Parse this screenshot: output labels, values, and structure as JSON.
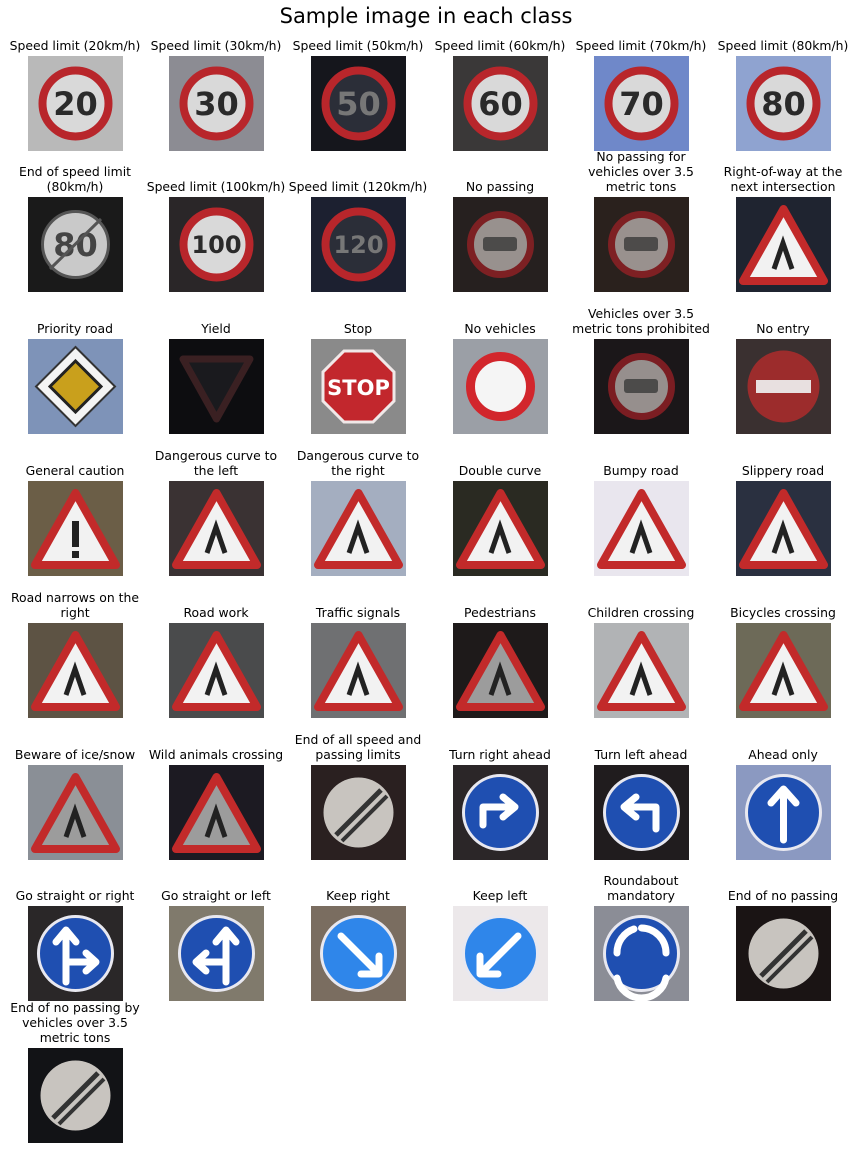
{
  "figure": {
    "title": "Sample image in each class"
  },
  "classes": [
    {
      "label": "Speed limit (20km/h)",
      "bg": "#b9b9b9",
      "sign": "speed",
      "text": "20"
    },
    {
      "label": "Speed limit (30km/h)",
      "bg": "#8c8c93",
      "sign": "speed",
      "text": "30"
    },
    {
      "label": "Speed limit (50km/h)",
      "bg": "#15161c",
      "sign": "speed-dark",
      "text": "50"
    },
    {
      "label": "Speed limit (60km/h)",
      "bg": "#3a3838",
      "sign": "speed",
      "text": "60"
    },
    {
      "label": "Speed limit (70km/h)",
      "bg": "#6f88c9",
      "sign": "speed",
      "text": "70"
    },
    {
      "label": "Speed limit (80km/h)",
      "bg": "#8fa3d0",
      "sign": "speed",
      "text": "80"
    },
    {
      "label": "End of speed limit (80km/h)",
      "bg": "#1a1a1a",
      "sign": "end-speed",
      "text": "80"
    },
    {
      "label": "Speed limit (100km/h)",
      "bg": "#2a2628",
      "sign": "speed",
      "text": "100"
    },
    {
      "label": "Speed limit (120km/h)",
      "bg": "#1c2030",
      "sign": "speed-dark",
      "text": "120"
    },
    {
      "label": "No passing",
      "bg": "#26201f",
      "sign": "prohibit",
      "text": ""
    },
    {
      "label": "No passing for vehicles over 3.5 metric tons",
      "bg": "#2a211d",
      "sign": "prohibit",
      "text": ""
    },
    {
      "label": "Right-of-way at the next intersection",
      "bg": "#1f2430",
      "sign": "triangle",
      "text": ""
    },
    {
      "label": "Priority road",
      "bg": "#7e93b8",
      "sign": "priority",
      "text": ""
    },
    {
      "label": "Yield",
      "bg": "#0d0d10",
      "sign": "yield",
      "text": ""
    },
    {
      "label": "Stop",
      "bg": "#8a8a8a",
      "sign": "stop",
      "text": "STOP"
    },
    {
      "label": "No vehicles",
      "bg": "#9b9fa6",
      "sign": "no-vehicles",
      "text": ""
    },
    {
      "label": "Vehicles over 3.5 metric tons prohibited",
      "bg": "#1b1719",
      "sign": "prohibit",
      "text": ""
    },
    {
      "label": "No entry",
      "bg": "#3a3030",
      "sign": "no-entry",
      "text": ""
    },
    {
      "label": "General caution",
      "bg": "#6b5e47",
      "sign": "triangle",
      "text": "!"
    },
    {
      "label": "Dangerous curve to the left",
      "bg": "#3a3233",
      "sign": "triangle",
      "text": ""
    },
    {
      "label": "Dangerous curve to the right",
      "bg": "#a4aec0",
      "sign": "triangle",
      "text": ""
    },
    {
      "label": "Double curve",
      "bg": "#2a2a22",
      "sign": "triangle",
      "text": ""
    },
    {
      "label": "Bumpy road",
      "bg": "#e9e6ee",
      "sign": "triangle",
      "text": ""
    },
    {
      "label": "Slippery road",
      "bg": "#2a3040",
      "sign": "triangle",
      "text": ""
    },
    {
      "label": "Road narrows on the right",
      "bg": "#5d5344",
      "sign": "triangle",
      "text": ""
    },
    {
      "label": "Road work",
      "bg": "#4a4b4c",
      "sign": "triangle",
      "text": ""
    },
    {
      "label": "Traffic signals",
      "bg": "#6f7072",
      "sign": "triangle",
      "text": ""
    },
    {
      "label": "Pedestrians",
      "bg": "#1e1a1a",
      "sign": "triangle-dark",
      "text": ""
    },
    {
      "label": "Children crossing",
      "bg": "#b1b3b5",
      "sign": "triangle",
      "text": ""
    },
    {
      "label": "Bicycles crossing",
      "bg": "#6d6a58",
      "sign": "triangle",
      "text": ""
    },
    {
      "label": "Beware of ice/snow",
      "bg": "#8a8f96",
      "sign": "triangle-dark",
      "text": ""
    },
    {
      "label": "Wild animals crossing",
      "bg": "#1c1a22",
      "sign": "triangle-dark",
      "text": ""
    },
    {
      "label": "End of all speed and passing limits",
      "bg": "#2a2020",
      "sign": "end-limits",
      "text": ""
    },
    {
      "label": "Turn right ahead",
      "bg": "#2b2628",
      "sign": "blue",
      "text": "arrow-right"
    },
    {
      "label": "Turn left ahead",
      "bg": "#201c1e",
      "sign": "blue",
      "text": "arrow-left"
    },
    {
      "label": "Ahead only",
      "bg": "#8b99c1",
      "sign": "blue",
      "text": "arrow-up"
    },
    {
      "label": "Go straight or right",
      "bg": "#2a2728",
      "sign": "blue",
      "text": "arrow-up-right"
    },
    {
      "label": "Go straight or left",
      "bg": "#807a6c",
      "sign": "blue",
      "text": "arrow-up-left"
    },
    {
      "label": "Keep right",
      "bg": "#7a6d60",
      "sign": "blue-bright",
      "text": "arrow-down-right"
    },
    {
      "label": "Keep left",
      "bg": "#ece8ea",
      "sign": "blue-bright",
      "text": "arrow-down-left"
    },
    {
      "label": "Roundabout mandatory",
      "bg": "#8b8d96",
      "sign": "blue",
      "text": "roundabout"
    },
    {
      "label": "End of no passing",
      "bg": "#1a1414",
      "sign": "end-limits",
      "text": ""
    },
    {
      "label": "End of no passing by vehicles over 3.5 metric tons",
      "bg": "#121316",
      "sign": "end-limits",
      "text": ""
    }
  ]
}
